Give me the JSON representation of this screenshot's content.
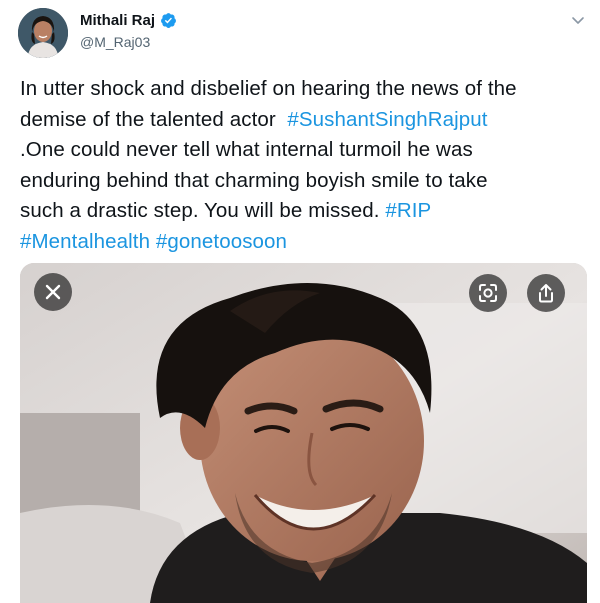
{
  "user": {
    "display_name": "Mithali Raj",
    "handle": "@M_Raj03",
    "verified": true
  },
  "tweet": {
    "lines": [
      [
        {
          "text": "In utter shock and disbelief on hearing the news of the",
          "kind": "text"
        }
      ],
      [
        {
          "text": "demise of the talented actor  ",
          "kind": "text"
        },
        {
          "text": "#SushantSinghRajput",
          "kind": "hashtag"
        }
      ],
      [
        {
          "text": ".One could never tell what internal turmoil he was",
          "kind": "text"
        }
      ],
      [
        {
          "text": "enduring behind that charming boyish smile to take",
          "kind": "text"
        }
      ],
      [
        {
          "text": "such a drastic step. You will be missed. ",
          "kind": "text"
        },
        {
          "text": "#RIP",
          "kind": "hashtag"
        }
      ],
      [
        {
          "text": "#Mentalhealth",
          "kind": "hashtag"
        },
        {
          "text": " ",
          "kind": "text"
        },
        {
          "text": "#gonetoosoon",
          "kind": "hashtag"
        }
      ]
    ]
  },
  "media": {
    "buttons": [
      {
        "name": "close-button",
        "icon": "close-icon"
      },
      {
        "name": "lens-button",
        "icon": "lens-icon"
      },
      {
        "name": "share-button",
        "icon": "share-icon"
      }
    ]
  },
  "colors": {
    "hashtag": "#1b95e0",
    "text": "#0f1419",
    "handle": "#536471",
    "verified": "#1d9bf0"
  }
}
